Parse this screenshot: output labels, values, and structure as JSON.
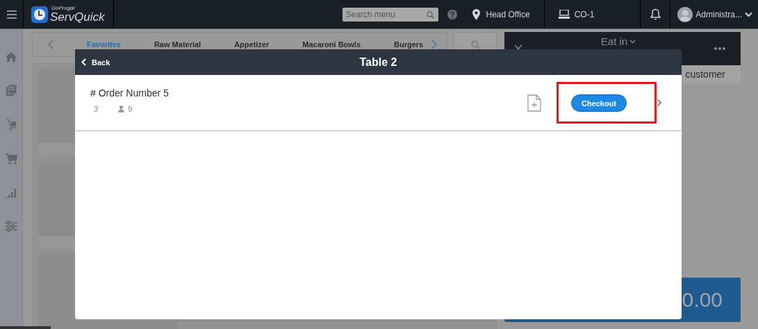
{
  "topbar": {
    "logo_small": "GoFrugal",
    "logo": "ServQuick",
    "search": {
      "placeholder": "Search menu"
    },
    "location": "Head Office",
    "counter": "CO-1",
    "user": "Administra..."
  },
  "categories": [
    {
      "label": "Favorites",
      "selected": true
    },
    {
      "label": "Raw Material",
      "selected": false
    },
    {
      "label": "Appetizer",
      "selected": false
    },
    {
      "label": "Macaroni Bowls",
      "selected": false
    },
    {
      "label": "Burgers",
      "selected": false
    }
  ],
  "order_panel": {
    "mode": "Eat in",
    "customer": "customer",
    "total": "0.00"
  },
  "modal": {
    "back": "Back",
    "title": "Table 2",
    "orders": [
      {
        "title": "# Order Number 5",
        "items": "3",
        "guests": "9",
        "action": "Checkout",
        "highlighted": true
      }
    ]
  }
}
